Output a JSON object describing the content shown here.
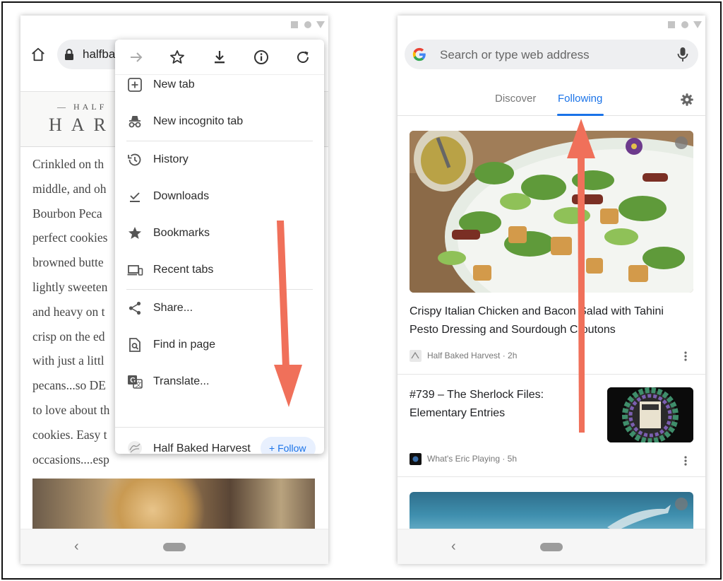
{
  "left_phone": {
    "url_text": "halfba",
    "site_logo": {
      "top": "— HALF",
      "main": "HAR"
    },
    "article_lines": [
      "Crinkled on th",
      "middle, and oh",
      "Bourbon Peca",
      "perfect cookies",
      "browned butte",
      "lightly sweeten",
      "and heavy on t",
      "crisp on the ed",
      "with just a littl",
      "pecans...so DE",
      "to love about th",
      "cookies. Easy t",
      "occasions....esp"
    ],
    "menu": {
      "items": [
        {
          "label": "New tab",
          "icon": "add-box-icon"
        },
        {
          "label": "New incognito tab",
          "icon": "incognito-icon"
        },
        {
          "label": "History",
          "icon": "history-icon"
        },
        {
          "label": "Downloads",
          "icon": "downloads-icon"
        },
        {
          "label": "Bookmarks",
          "icon": "star-filled-icon"
        },
        {
          "label": "Recent tabs",
          "icon": "devices-icon"
        },
        {
          "label": "Share...",
          "icon": "share-icon"
        },
        {
          "label": "Find in page",
          "icon": "find-in-page-icon"
        },
        {
          "label": "Translate...",
          "icon": "translate-icon"
        }
      ],
      "site_name": "Half Baked Harvest",
      "follow_label": "+ Follow"
    }
  },
  "right_phone": {
    "search_placeholder": "Search or type web address",
    "tabs": {
      "discover": "Discover",
      "following": "Following"
    },
    "cards": [
      {
        "title": "Crispy Italian Chicken and Bacon Salad with Tahini Pesto Dressing and Sourdough Croutons",
        "source": "Half Baked Harvest · 2h"
      },
      {
        "title": "#739 – The Sherlock Files: Elementary Entries",
        "source": "What's Eric Playing · 5h"
      }
    ]
  },
  "colors": {
    "accent_blue": "#1a73e8",
    "arrow_red": "#f0705a",
    "follow_bg": "#e8f0fe"
  }
}
